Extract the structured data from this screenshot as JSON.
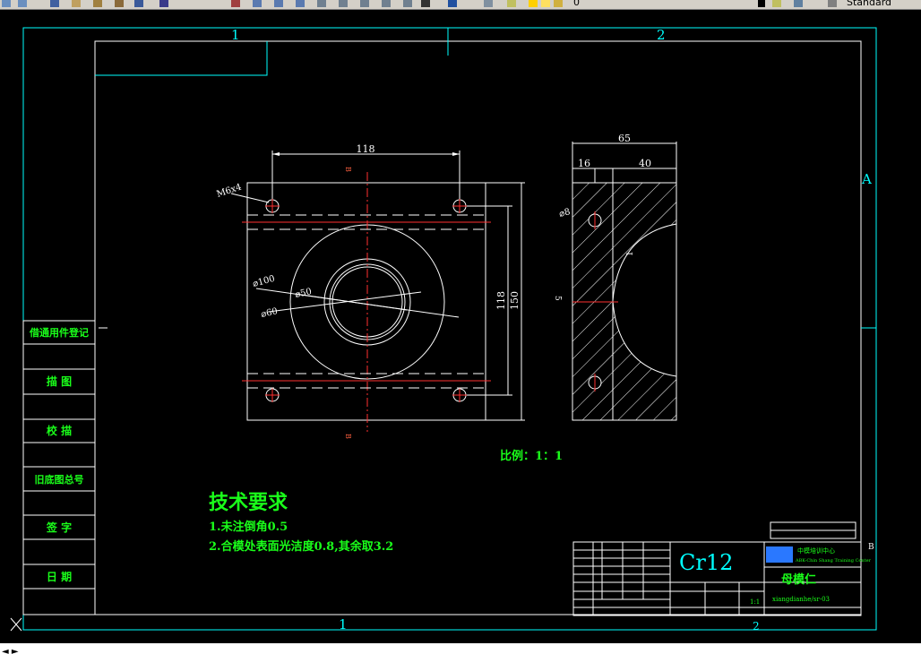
{
  "toolbar": {
    "style_value": "Standard",
    "layer_value": "0"
  },
  "frame": {
    "zone_top_1": "1",
    "zone_top_2": "2",
    "zone_bottom_1": "1",
    "zone_bottom_2": "2",
    "zone_right_a": "A",
    "zone_right_b": "B"
  },
  "side_table": [
    "借通用件登记",
    "描 图",
    "校 描",
    "旧底图总号",
    "签 字",
    "日 期"
  ],
  "front_view": {
    "dim_width_top": "118",
    "dim_height_inner": "118",
    "dim_height_outer": "150",
    "section_top": "B",
    "section_bottom": "B",
    "note_holes": "M6x4",
    "dia_100": "⌀100",
    "dia_50": "⌀50",
    "dia_60": "⌀60"
  },
  "side_view": {
    "dim_total": "65",
    "dim_left": "16",
    "dim_right": "40",
    "dia_8": "⌀8",
    "dim_1": "1",
    "dim_5": "5"
  },
  "scale_label": "比例：1：1",
  "tech": {
    "title": "技术要求",
    "line1": "1.未注倒角0.5",
    "line2": "2.合模处表面光洁度0.8,其余取3.2"
  },
  "title_block": {
    "material": "Cr12",
    "part_name": "母模仁",
    "company_cn": "中模培训中心",
    "company_en": "ABK-Chin Shang Training Center",
    "drawing_no": "xiangdianhe/sr-03",
    "scale_val": "1:1"
  },
  "colors": {
    "frame": "#00ffff",
    "paper_border": "#ffffff",
    "annotation": "#1aff1a",
    "center_line": "#ff3030"
  }
}
